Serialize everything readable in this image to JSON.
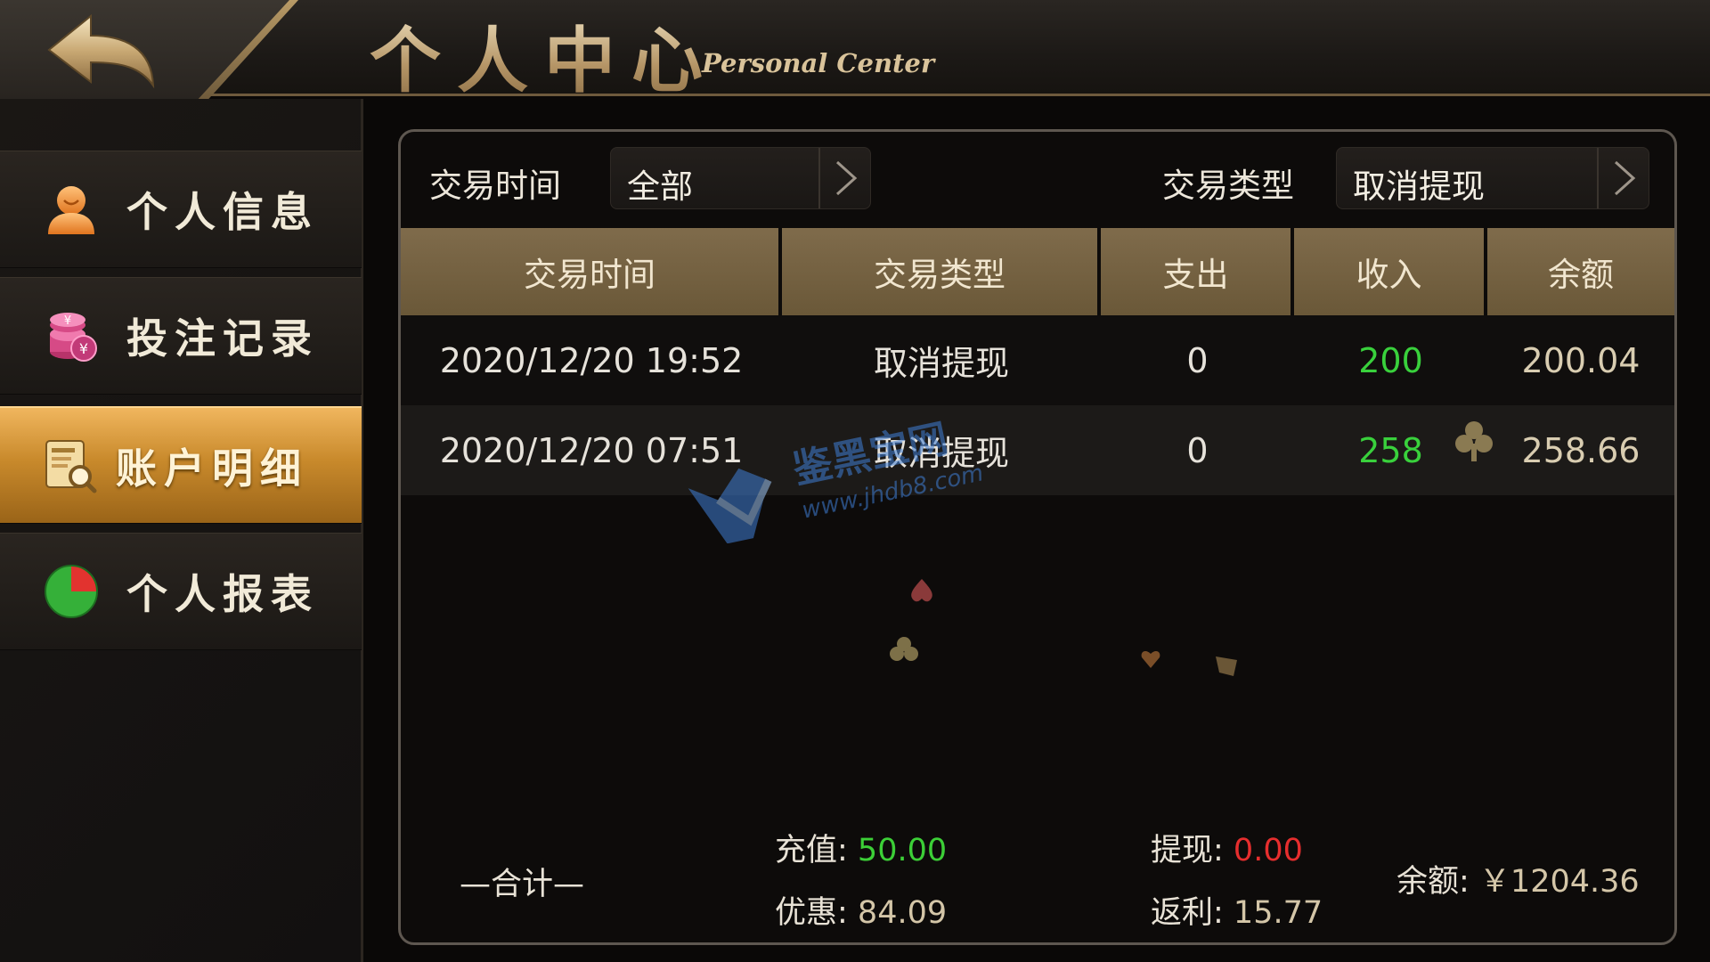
{
  "header": {
    "title": "个人中心",
    "subtitle": "Personal Center",
    "back_icon": "back-arrow-icon"
  },
  "sidebar": {
    "items": [
      {
        "label": "个人信息",
        "icon": "user-icon",
        "active": false
      },
      {
        "label": "投注记录",
        "icon": "coins-icon",
        "active": false
      },
      {
        "label": "账户明细",
        "icon": "ledger-search-icon",
        "active": true
      },
      {
        "label": "个人报表",
        "icon": "pie-chart-icon",
        "active": false
      }
    ]
  },
  "filters": {
    "time_label": "交易时间",
    "time_value": "全部",
    "type_label": "交易类型",
    "type_value": "取消提现"
  },
  "table": {
    "columns": [
      "交易时间",
      "交易类型",
      "支出",
      "收入",
      "余额"
    ],
    "rows": [
      [
        "2020/12/20 19:52",
        "取消提现",
        "0",
        "200",
        "200.04"
      ],
      [
        "2020/12/20 07:51",
        "取消提现",
        "0",
        "258",
        "258.66"
      ]
    ]
  },
  "footer": {
    "total_label": "—合计—",
    "recharge_label": "充值: ",
    "recharge_value": "50.00",
    "bonus_label": "优惠: ",
    "bonus_value": "84.09",
    "withdraw_label": "提现: ",
    "withdraw_value": "0.00",
    "rebate_label": "返利: ",
    "rebate_value": "15.77",
    "balance_label": "余额: ",
    "balance_value": "￥1204.36"
  },
  "watermark": {
    "text": "鉴黑宝网",
    "url": "www.jhdb8.com"
  },
  "colors": {
    "accent_gold": "#c98a2c",
    "income_green": "#39d13c",
    "withdraw_red": "#e62e2e",
    "header_brown": "#7f6b4b"
  }
}
